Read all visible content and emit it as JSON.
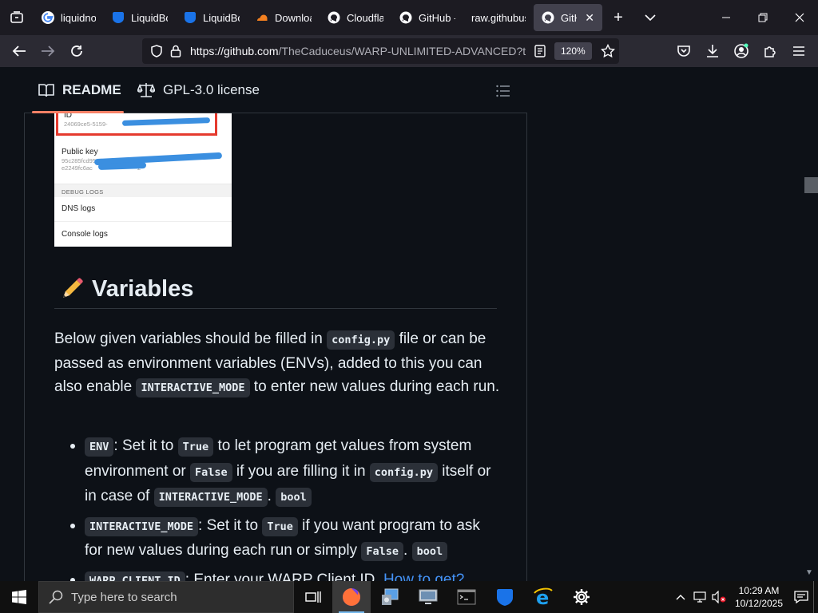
{
  "browser": {
    "tabs": [
      {
        "label": "liquidno",
        "icon": "google-icon",
        "active": false
      },
      {
        "label": "LiquidBo",
        "icon": "shield-icon",
        "active": false
      },
      {
        "label": "LiquidBo",
        "icon": "shield-icon",
        "active": false
      },
      {
        "label": "Downloa",
        "icon": "cloudflare-icon",
        "active": false
      },
      {
        "label": "Cloudfla",
        "icon": "github-icon",
        "active": false
      },
      {
        "label": "GitHub -",
        "icon": "github-icon",
        "active": false
      },
      {
        "label": "raw.githubus",
        "icon": "none",
        "active": false
      },
      {
        "label": "GitHu",
        "icon": "github-icon",
        "active": true
      }
    ],
    "url_host": "https://github.com",
    "url_path": "/TheCaduceus/WARP-UNLIMITED-ADVANCED?tab",
    "zoom": "120%"
  },
  "readme_header": {
    "readme_tab": "README",
    "license_tab": "GPL-3.0 license"
  },
  "screenshot_image": {
    "id_label": "ID",
    "id_value": "24069ce5-5159-",
    "public_key_label": "Public key",
    "public_key_line1": "95c285fcd95",
    "public_key_line2": "e2249fc6ac",
    "public_key_tail": "2",
    "debug_logs": "DEBUG LOGS",
    "dns_logs": "DNS logs",
    "console_logs": "Console logs"
  },
  "content": {
    "heading_icon": "pencil-icon",
    "heading": "Variables",
    "intro": {
      "p1": "Below given variables should be filled in ",
      "c1": "config.py",
      "p2": " file or can be passed as environment variables (ENVs), added to this you can also enable ",
      "c2": "INTERACTIVE_MODE",
      "p3": " to enter new values during each run."
    },
    "items": [
      {
        "c0": "ENV",
        "t1": ": Set it to ",
        "c1": "True",
        "t2": " to let program get values from system environment or ",
        "c2": "False",
        "t3": " if you are filling it in ",
        "c3": "config.py",
        "t4": " itself or in case of ",
        "c4": "INTERACTIVE_MODE",
        "t5": ". ",
        "c5": "bool"
      },
      {
        "c0": "INTERACTIVE_MODE",
        "t1": ": Set it to ",
        "c1": "True",
        "t2": " if you want program to ask for new values during each run or simply ",
        "c2": "False",
        "t3": ". ",
        "c3": "bool"
      },
      {
        "c0": "WARP_CLIENT_ID",
        "t1": ": Enter your WARP Client ID. ",
        "link": "How to get?",
        "t2": "."
      }
    ]
  },
  "taskbar": {
    "search_placeholder": "Type here to search",
    "time": "10:29 AM",
    "date": "10/12/2025"
  }
}
